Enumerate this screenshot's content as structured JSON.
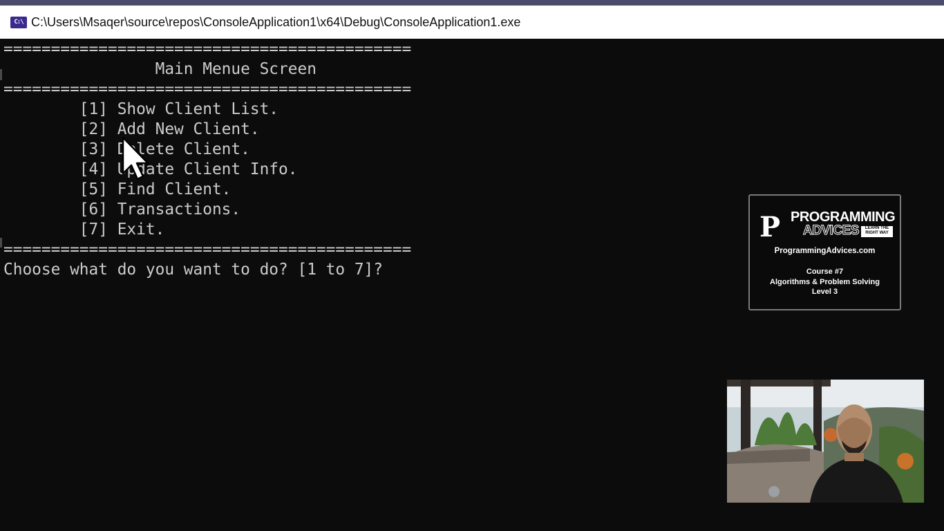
{
  "window": {
    "icon_text": "C:\\",
    "title": "C:\\Users\\Msaqer\\source\\repos\\ConsoleApplication1\\x64\\Debug\\ConsoleApplication1.exe"
  },
  "console": {
    "separator": "===========================================",
    "heading": "                Main Menue Screen",
    "menu": [
      "        [1] Show Client List.",
      "        [2] Add New Client.",
      "        [3] Delete Client.",
      "        [4] Update Client Info.",
      "        [5] Find Client.",
      "        [6] Transactions.",
      "        [7] Exit."
    ],
    "prompt": "Choose what do you want to do? [1 to 7]?"
  },
  "brand_card": {
    "logo_letter": "P",
    "logo_line1": "PROGRAMMING",
    "logo_line2": "ADVICES",
    "logo_tagline": "LEARN THE RIGHT WAY",
    "website": "ProgrammingAdvices.com",
    "course_number": "Course #7",
    "course_title": "Algorithms & Problem Solving",
    "course_level": "Level 3"
  },
  "colors": {
    "console_bg": "#0c0c0c",
    "console_text": "#cccccc",
    "titlebar_bg": "#ffffff",
    "icon_bg": "#3b2a8e"
  },
  "icons": [
    "console-app-icon",
    "mouse-pointer-icon",
    "programming-advices-logo"
  ]
}
